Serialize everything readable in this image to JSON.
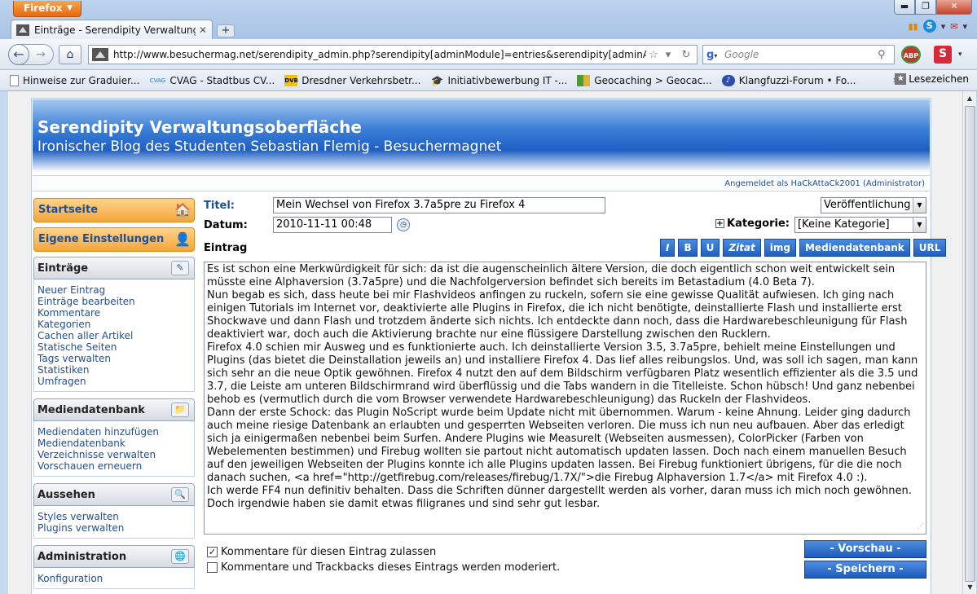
{
  "browser": {
    "menu_label": "Firefox",
    "tab_title": "Einträge - Serendipity Verwaltungsober...",
    "url": "http://www.besuchermag.net/serendipity_admin.php?serendipity[adminModule]=entries&serendipity[adminAction]=new",
    "search_placeholder": "Google",
    "abp_label": "ABP",
    "s_label": "S",
    "bookmarks": [
      {
        "label": "Hinweise zur Graduier...",
        "icon": "page-icon"
      },
      {
        "label": "CVAG - Stadtbus CV...",
        "icon_text": "CVAG",
        "icon": "cvag-icon"
      },
      {
        "label": "Dresdner Verkehrsbetr...",
        "icon_text": "DVB",
        "icon": "dvb-icon"
      },
      {
        "label": "Initiativbewerbung IT -...",
        "icon": "grad-cap-icon"
      },
      {
        "label": "Geocaching > Geocac...",
        "icon": "geocaching-icon"
      },
      {
        "label": "Klangfuzzi-Forum • Fo...",
        "icon": "forum-icon"
      }
    ],
    "bookmarks_more": "»",
    "bookmarks_menu": "Lesezeichen"
  },
  "header": {
    "title": "Serendipity Verwaltungsoberfläche",
    "subtitle": "Ironischer Blog des Studenten Sebastian Flemig - Besuchermagnet",
    "login": "Angemeldet als HaCkAttaCk2001 (Administrator)"
  },
  "sidebar": {
    "home": "Startseite",
    "personal": "Eigene Einstellungen",
    "sections": [
      {
        "title": "Einträge",
        "links": [
          "Neuer Eintrag",
          "Einträge bearbeiten",
          "Kommentare",
          "Kategorien",
          "Cachen aller Artikel",
          "Statische Seiten",
          "Tags verwalten",
          "Statistiken",
          "Umfragen"
        ]
      },
      {
        "title": "Mediendatenbank",
        "links": [
          "Mediendaten hinzufügen",
          "Mediendatenbank",
          "Verzeichnisse verwalten",
          "Vorschauen erneuern"
        ]
      },
      {
        "title": "Aussehen",
        "links": [
          "Styles verwalten",
          "Plugins verwalten"
        ]
      },
      {
        "title": "Administration",
        "links": [
          "Konfiguration"
        ]
      }
    ]
  },
  "form": {
    "title_label": "Titel:",
    "title_value": "Mein Wechsel von Firefox 3.7a5pre zu Firefox 4",
    "date_label": "Datum:",
    "date_value": "2010-11-11 00:48",
    "status_value": "Veröffentlichung",
    "category_label": "Kategorie:",
    "category_value": "[Keine Kategorie]",
    "entry_label": "Eintrag",
    "toolbar": [
      "I",
      "B",
      "U",
      "Zitat",
      "img",
      "Mediendatenbank",
      "URL"
    ],
    "body": [
      "Es ist schon eine Merkwürdigkeit für sich: da ist die augenscheinlich ältere Version, die doch eigentlich schon weit entwickelt sein müsste eine Alphaversion (3.7a5pre) und die Nachfolgerversion befindet sich bereits im Betastadium (4.0 Beta 7).",
      "Nun begab es sich, dass heute bei mir Flashvideos anfingen zu ruckeln, sofern sie eine gewisse Qualität aufwiesen. Ich ging nach einigen Tutorials im Internet vor, deaktivierte alle Plugins in Firefox, die ich nicht benötigte, deinstallierte Flash und installierte erst Shockwave und dann Flash und trotzdem änderte sich nichts. Ich entdeckte dann noch, dass die Hardwarebeschleunigung für Flash deaktiviert war, doch auch die Aktivierung brachte nur eine flüssigere Darstellung zwischen den Rucklern.",
      "Firefox 4.0 schien mir Ausweg und es funktionierte auch. Ich deinstallierte Version 3.5, 3.7a5pre, behielt meine Einstellungen und Plugins (das bietet die Deinstallation jeweils an) und installiere Firefox 4. Das lief alles reibungslos. Und, was soll ich sagen, man kann sich sehr an die neue Optik gewöhnen. Firefox 4 nutzt den auf dem Bildschirm verfügbaren Platz wesentlich effizienter als die 3.5 und 3.7, die Leiste am unteren Bildschirmrand wird überflüssig und die Tabs wandern in die Titelleiste. Schon hübsch! Und ganz nebenbei behob es (vermutlich durch die vom Browser verwendete Hardwarebeschleunigung) das Ruckeln der Flashvideos.",
      "Dann der erste Schock: das Plugin NoScript wurde beim Update nicht mit übernommen. Warum - keine Ahnung. Leider ging dadurch auch meine riesige Datenbank an erlaubten und gesperrten Webseiten verloren. Die muss ich nun neu aufbauen. Aber das erledigt sich ja einigermaßen nebenbei beim Surfen. Andere Plugins wie MeasureIt (Webseiten ausmessen), ColorPicker (Farben von Webelementen bestimmen) und Firebug wollten sie partout nicht automatisch updaten lassen. Doch nach einem manuellen Besuch auf den jeweiligen Webseiten der Plugins konnte ich alle Plugins updaten lassen. Bei Firebug funktioniert übrigens, für die die noch danach suchen, <a href=\"http://getfirebug.com/releases/firebug/1.7X/\">die Firebug Alphaversion 1.7</a> mit Firefox 4.0 :).",
      "Ich werde FF4 nun definitiv behalten. Dass die Schriften dünner dargestellt werden als vorher, daran muss ich mich noch gewöhnen. Doch irgendwie haben sie damit etwas filigranes und sind sehr gut lesbar."
    ],
    "allow_comments": "Kommentare für diesen Eintrag zulassen",
    "moderate_comments": "Kommentare und Trackbacks dieses Eintrags werden moderiert.",
    "preview_button": "- Vorschau -",
    "save_button": "- Speichern -"
  }
}
